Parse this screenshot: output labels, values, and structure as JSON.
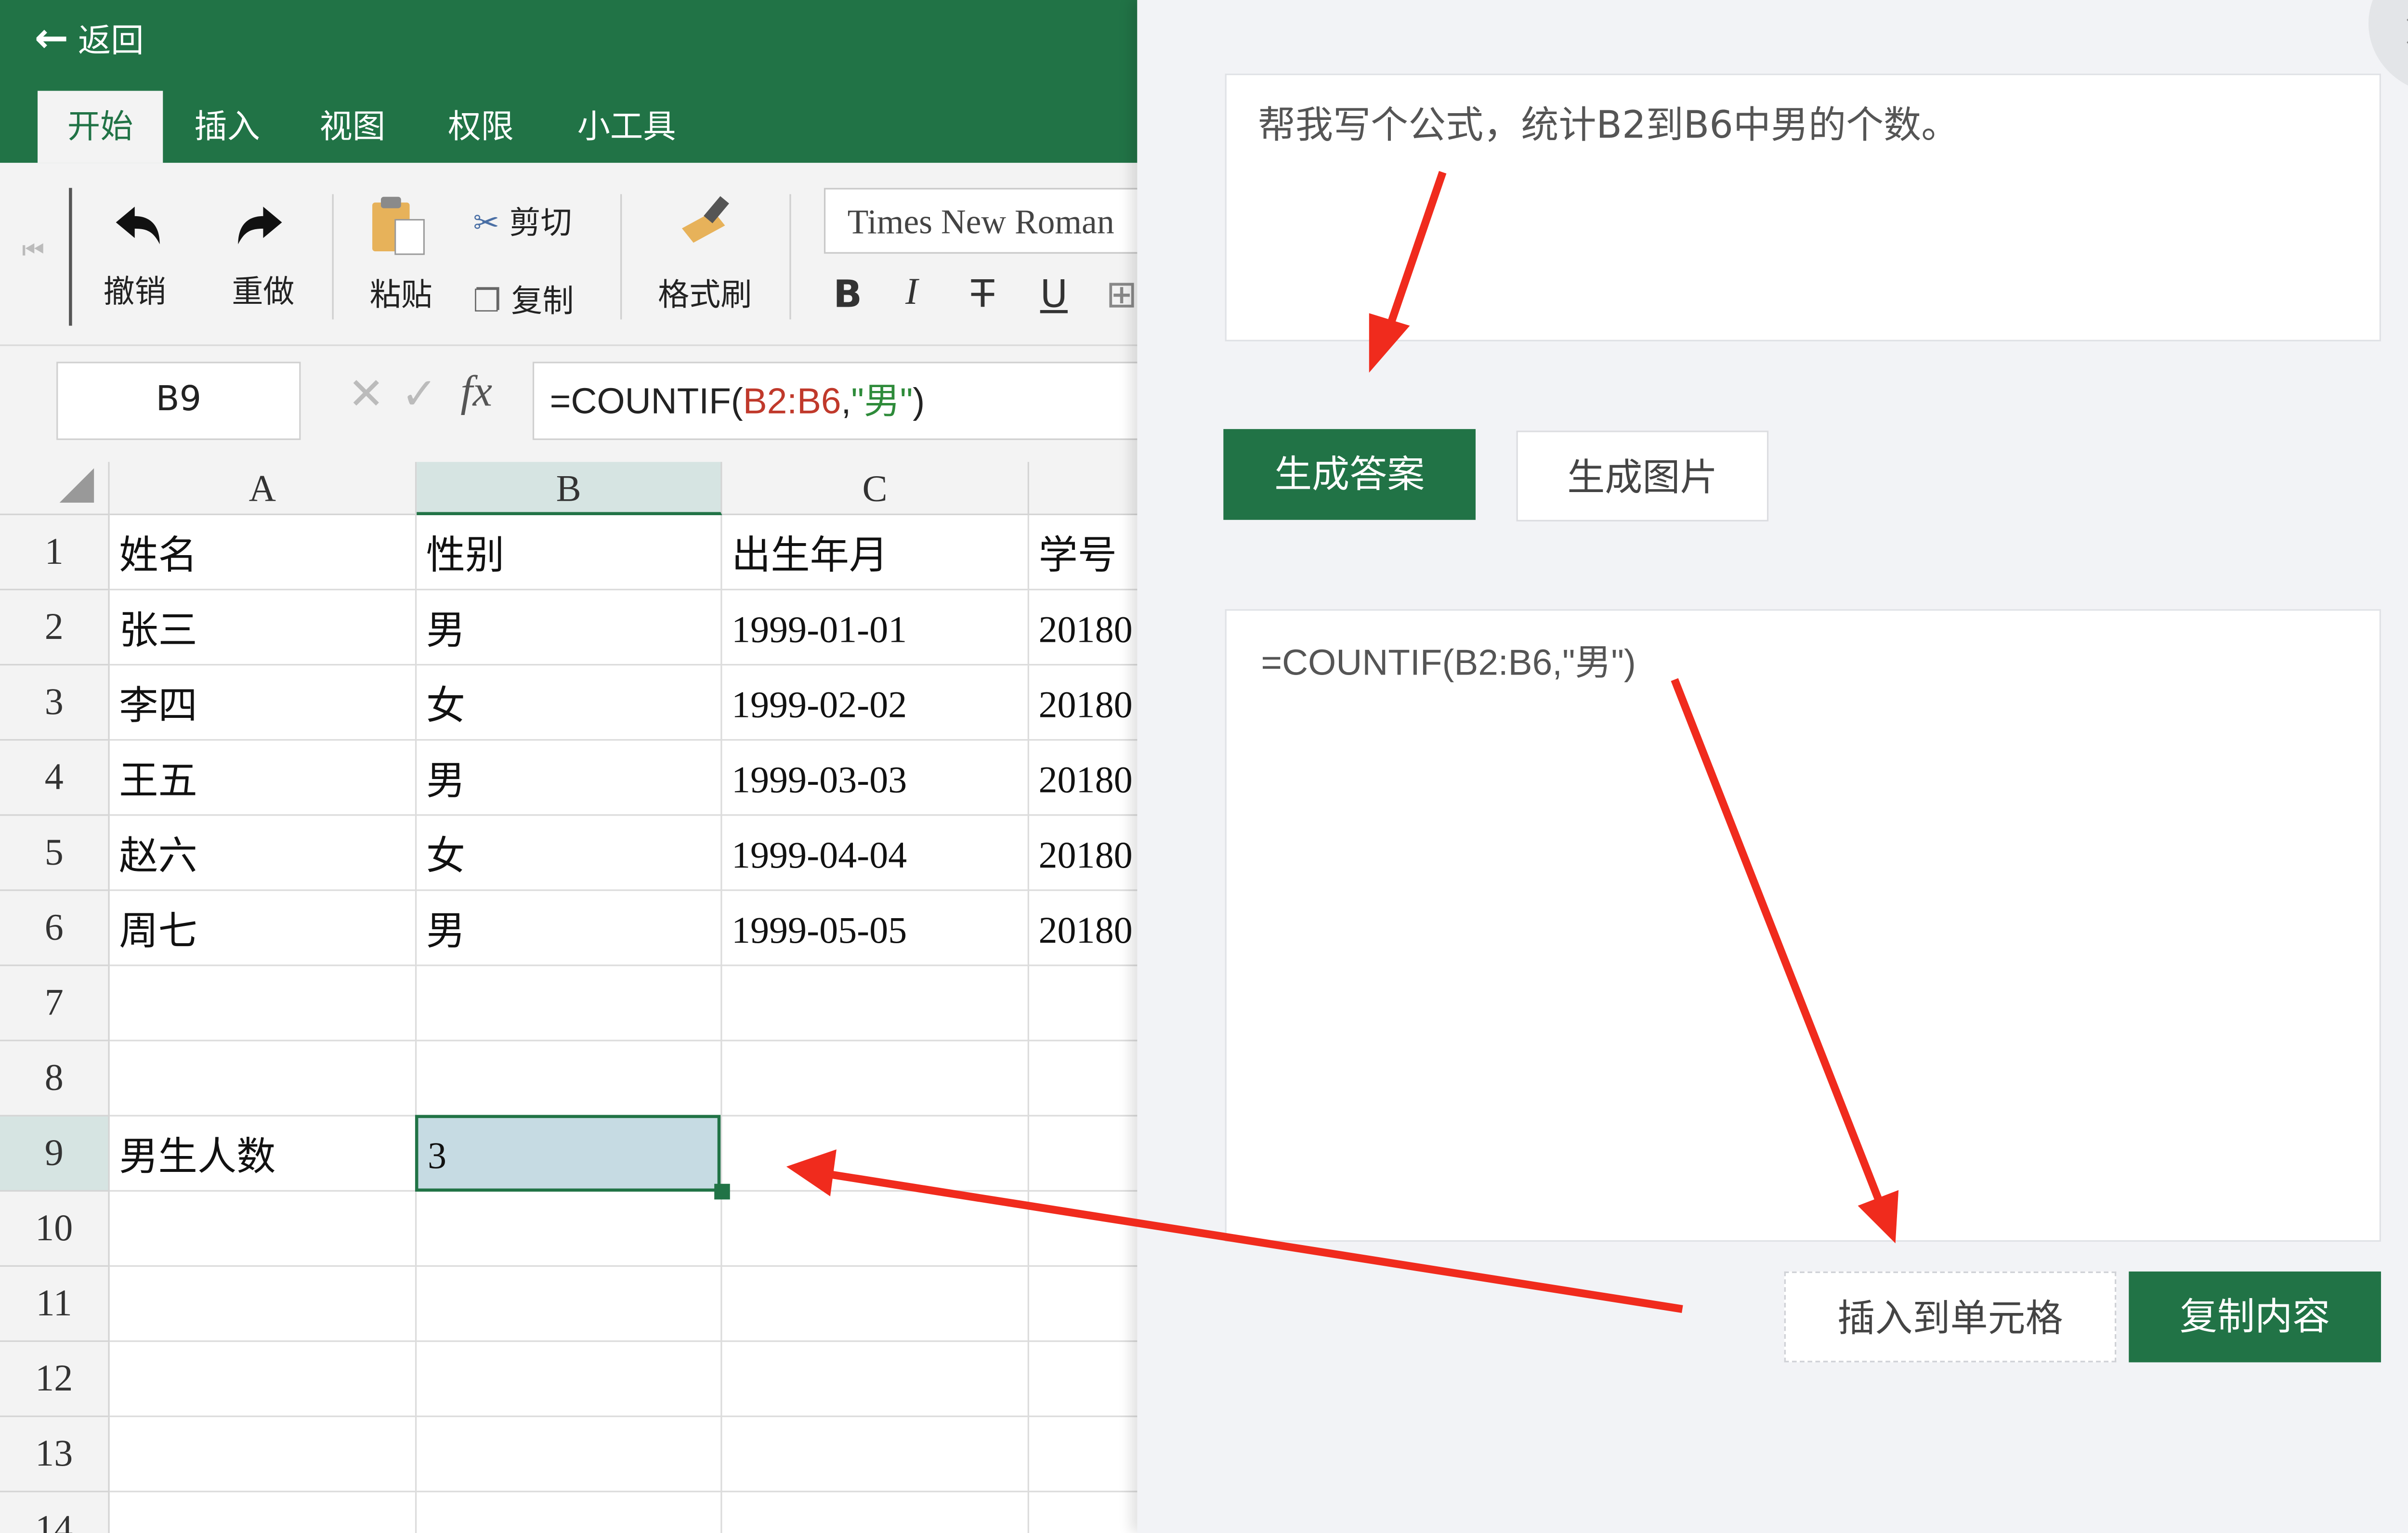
{
  "header": {
    "back_label": "返回",
    "tabs": [
      {
        "label": "开始",
        "active": true
      },
      {
        "label": "插入"
      },
      {
        "label": "视图"
      },
      {
        "label": "权限"
      },
      {
        "label": "小工具"
      }
    ]
  },
  "toolbar": {
    "undo_label": "撤销",
    "redo_label": "重做",
    "paste_label": "粘贴",
    "cut_label": "剪切",
    "copy_label": "复制",
    "format_painter_label": "格式刷",
    "font_name": "Times New Roman",
    "bold": "B",
    "italic": "I",
    "strike": "T",
    "underline": "U"
  },
  "formula_bar": {
    "cell_ref": "B9",
    "fx": "fx",
    "formula_prefix": "=COUNTIF(",
    "formula_range": "B2:B6",
    "formula_comma": ",",
    "formula_criteria": "\"男\"",
    "formula_suffix": ")"
  },
  "sheet": {
    "columns": [
      "A",
      "B",
      "C"
    ],
    "rows": [
      "1",
      "2",
      "3",
      "4",
      "5",
      "6",
      "7",
      "8",
      "9",
      "10",
      "11",
      "12",
      "13",
      "14"
    ],
    "cells": [
      [
        "姓名",
        "性别",
        "出生年月",
        "学号"
      ],
      [
        "张三",
        "男",
        "1999-01-01",
        "20180"
      ],
      [
        "李四",
        "女",
        "1999-02-02",
        "20180"
      ],
      [
        "王五",
        "男",
        "1999-03-03",
        "20180"
      ],
      [
        "赵六",
        "女",
        "1999-04-04",
        "20180"
      ],
      [
        "周七",
        "男",
        "1999-05-05",
        "20180"
      ]
    ],
    "summary_label": "男生人数",
    "summary_value": "3"
  },
  "panel": {
    "prompt_text": "帮我写个公式，统计B2到B6中男的个数。",
    "generate_answer_label": "生成答案",
    "generate_image_label": "生成图片",
    "result_text": "=COUNTIF(B2:B6,\"男\")",
    "insert_cell_label": "插入到单元格",
    "copy_content_label": "复制内容",
    "close_glyph": "×"
  },
  "colors": {
    "brand_green": "#217346",
    "annotation_red": "#f02b1d"
  }
}
